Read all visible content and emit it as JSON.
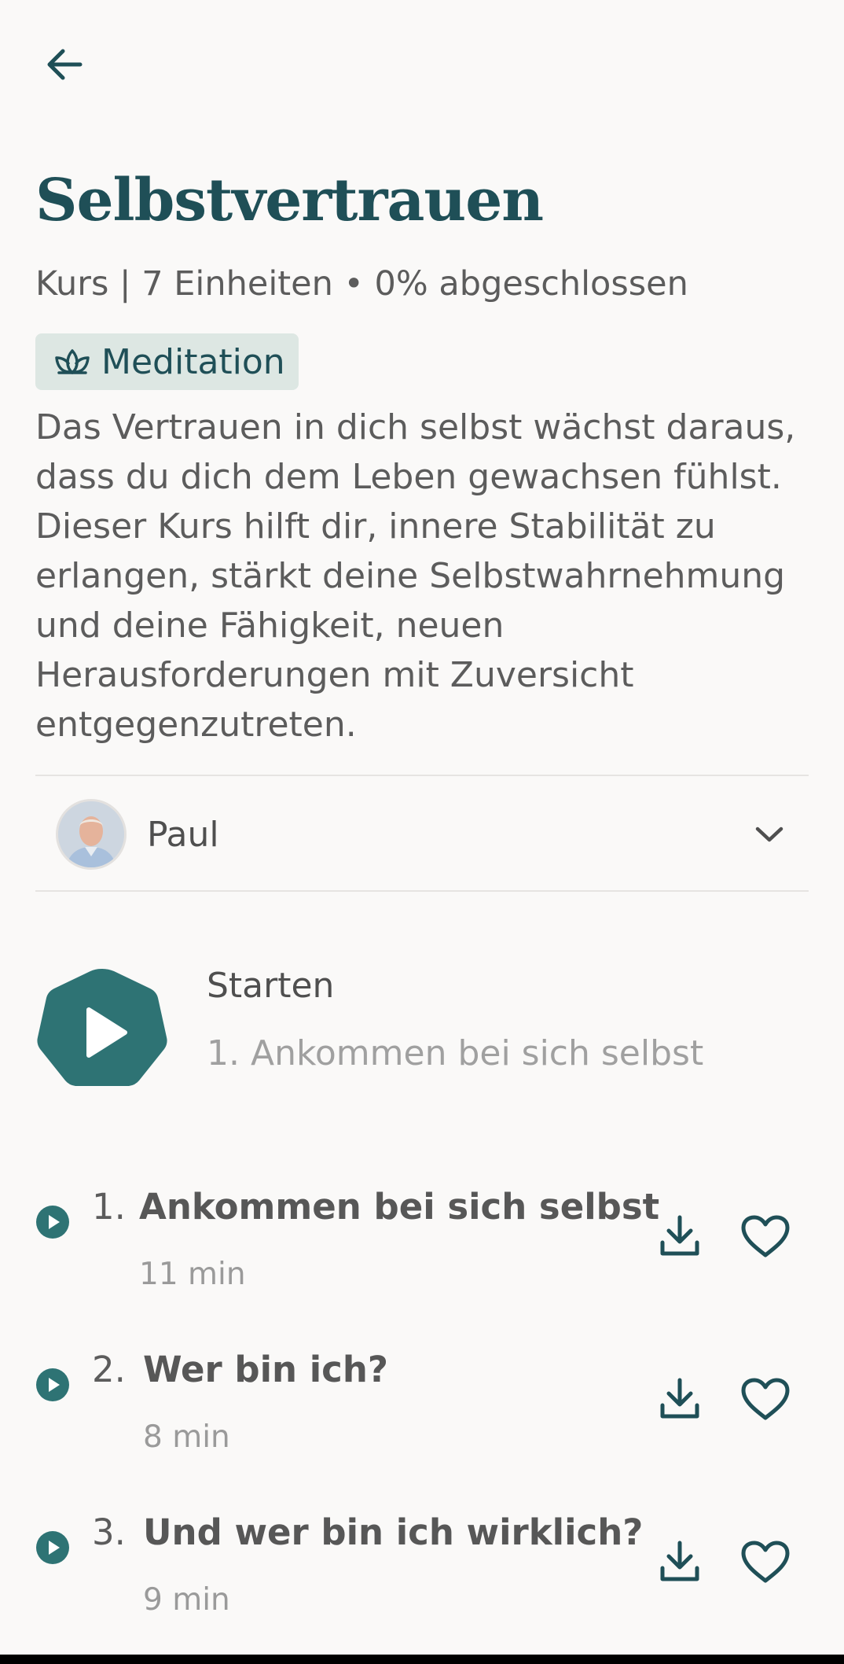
{
  "header": {
    "back_icon": "arrow-left-icon"
  },
  "course": {
    "title": "Selbstvertrauen",
    "meta": "Kurs | 7 Einheiten • 0% abgeschlossen",
    "tag": {
      "icon": "lotus-icon",
      "label": "Meditation"
    },
    "description": "Das Vertrauen in dich selbst wächst daraus, dass du dich dem Leben gewachsen fühlst. Dieser Kurs hilft dir, innere Stabilität zu erlangen, stärkt deine Selbstwahrnehmung und deine Fähigkeit, neuen Herausforderungen mit Zuversicht entgegenzutreten."
  },
  "teacher": {
    "name": "Paul",
    "icon": "chevron-down-icon"
  },
  "start": {
    "label": "Starten",
    "subtitle": "1. Ankommen bei sich selbst"
  },
  "units": [
    {
      "number": "1.",
      "title": "Ankommen bei sich selbst",
      "duration": "11 min"
    },
    {
      "number": "2.",
      "title": "Wer bin ich?",
      "duration": "8 min"
    },
    {
      "number": "3.",
      "title": "Und wer bin ich wirklich?",
      "duration": "9 min"
    }
  ],
  "colors": {
    "accent": "#2e7374",
    "title": "#1f4f57",
    "tag_bg": "#dde7e3",
    "background": "#faf9f8"
  }
}
